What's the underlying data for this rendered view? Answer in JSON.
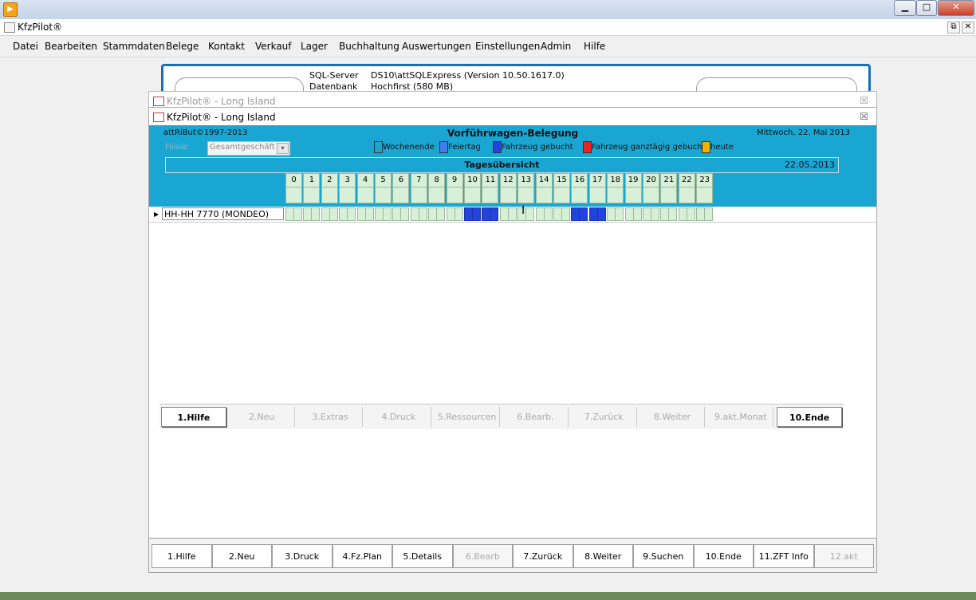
{
  "app": {
    "title": "KfzPilot®"
  },
  "menu": [
    "Datei",
    "Bearbeiten",
    "Stammdaten",
    "Belege",
    "Kontakt",
    "Verkauf",
    "Lager",
    "Buchhaltung",
    "Auswertungen",
    "Einstellungen",
    "Admin",
    "Hilfe"
  ],
  "background_form": {
    "sql_label": "SQL-Server",
    "sql_value": "DS10\\attSQLExpress  (Version 10.50.1617.0)",
    "db_label": "Datenbank",
    "db_value": "Hochfirst  (580 MB)"
  },
  "back_window": {
    "title": "KfzPilot® - Long Island",
    "close": "☒"
  },
  "front_window": {
    "title": "KfzPilot® - Long Island",
    "close": "☒"
  },
  "header": {
    "copyright": "attRiBut©1997-2013",
    "title": "Vorführwagen-Belegung",
    "date": "Mittwoch, 22. Mai 2013",
    "filter_label": "Filiale",
    "filter_value": "Gesamtgeschäft",
    "legend": [
      {
        "label": "Wochenende",
        "color": "#1aa6d2"
      },
      {
        "label": "Feiertag",
        "color": "#3d7ef0"
      },
      {
        "label": "Fahrzeug gebucht",
        "color": "#2244dd"
      },
      {
        "label": "Fahrzeug ganztägig gebucht",
        "color": "#ee2222"
      },
      {
        "label": "heute",
        "color": "#f0b000"
      }
    ],
    "overview_title": "Tagesübersicht",
    "overview_date": "22.05.2013"
  },
  "hours": [
    "0",
    "1",
    "2",
    "3",
    "4",
    "5",
    "6",
    "7",
    "8",
    "9",
    "10",
    "11",
    "12",
    "13",
    "14",
    "15",
    "16",
    "17",
    "18",
    "19",
    "20",
    "21",
    "22",
    "23"
  ],
  "vehicles": [
    {
      "name": "HH-HH 7770 (MONDEO)",
      "booked_hours": [
        10,
        11,
        16,
        17
      ]
    }
  ],
  "form_buttons": [
    {
      "label": "1.Hilfe",
      "enabled": true
    },
    {
      "label": "2.Neu",
      "enabled": false
    },
    {
      "label": "3.Extras",
      "enabled": false
    },
    {
      "label": "4.Druck",
      "enabled": false
    },
    {
      "label": "5.Ressourcen",
      "enabled": false
    },
    {
      "label": "6.Bearb.",
      "enabled": false
    },
    {
      "label": "7.Zurück",
      "enabled": false
    },
    {
      "label": "8.Weiter",
      "enabled": false
    },
    {
      "label": "9.akt.Monat",
      "enabled": false
    },
    {
      "label": "10.Ende",
      "enabled": true
    }
  ],
  "main_buttons": [
    {
      "label": "1.Hilfe",
      "enabled": true
    },
    {
      "label": "2.Neu",
      "enabled": true
    },
    {
      "label": "3.Druck",
      "enabled": true
    },
    {
      "label": "4.Fz.Plan",
      "enabled": true
    },
    {
      "label": "5.Details",
      "enabled": true
    },
    {
      "label": "6.Bearb",
      "enabled": false
    },
    {
      "label": "7.Zurück",
      "enabled": true
    },
    {
      "label": "8.Weiter",
      "enabled": true
    },
    {
      "label": "9.Suchen",
      "enabled": true
    },
    {
      "label": "10.Ende",
      "enabled": true
    },
    {
      "label": "11.ZFT Info",
      "enabled": true
    },
    {
      "label": "12.akt",
      "enabled": false
    }
  ],
  "icons": {
    "app": "app-logo-icon",
    "form": "form-icon",
    "row_selector": "row-selector-arrow-icon",
    "combo_arrow": "dropdown-arrow-icon",
    "cursor": "text-cursor-icon",
    "minimize": "minimize-icon",
    "maximize": "maximize-icon",
    "close": "close-icon",
    "restore": "restore-icon"
  },
  "glyphs": {
    "app": "▶",
    "minimize": "▁",
    "maximize": "□",
    "close": "✕",
    "restore": "⧉",
    "row_selector": "▶",
    "combo_arrow": "▾",
    "cursor": "Ι"
  }
}
